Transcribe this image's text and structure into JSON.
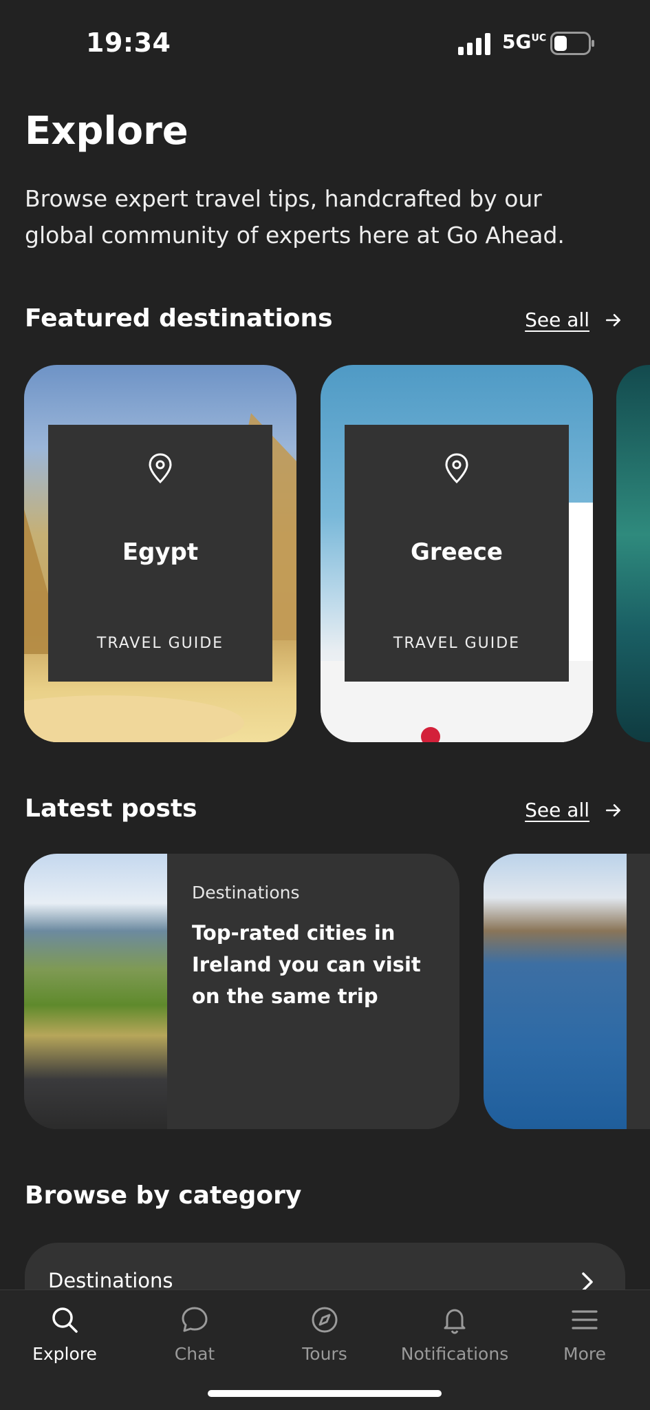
{
  "status_bar": {
    "time": "19:34",
    "network": "5G",
    "network_sup": "UC"
  },
  "header": {
    "title": "Explore",
    "subtitle": "Browse expert travel tips, handcrafted by our global community of experts here at Go Ahead."
  },
  "featured": {
    "title": "Featured destinations",
    "see_all": "See all",
    "cards": [
      {
        "name": "Egypt",
        "kind": "TRAVEL GUIDE",
        "icon": "location-pin-icon"
      },
      {
        "name": "Greece",
        "kind": "TRAVEL GUIDE",
        "icon": "location-pin-icon"
      }
    ]
  },
  "latest": {
    "title": "Latest posts",
    "see_all": "See all",
    "posts": [
      {
        "category": "Destinations",
        "title": "Top-rated cities in Ireland you can visit on the same trip"
      }
    ]
  },
  "browse": {
    "title": "Browse by category",
    "items": [
      {
        "label": "Destinations"
      }
    ]
  },
  "bottom_nav": {
    "items": [
      {
        "label": "Explore",
        "icon": "search-icon",
        "active": true
      },
      {
        "label": "Chat",
        "icon": "chat-icon",
        "active": false
      },
      {
        "label": "Tours",
        "icon": "compass-icon",
        "active": false
      },
      {
        "label": "Notifications",
        "icon": "bell-icon",
        "active": false
      },
      {
        "label": "More",
        "icon": "menu-icon",
        "active": false
      }
    ]
  },
  "colors": {
    "background": "#222222",
    "card": "#333333",
    "inactive": "#9a9a9a"
  }
}
